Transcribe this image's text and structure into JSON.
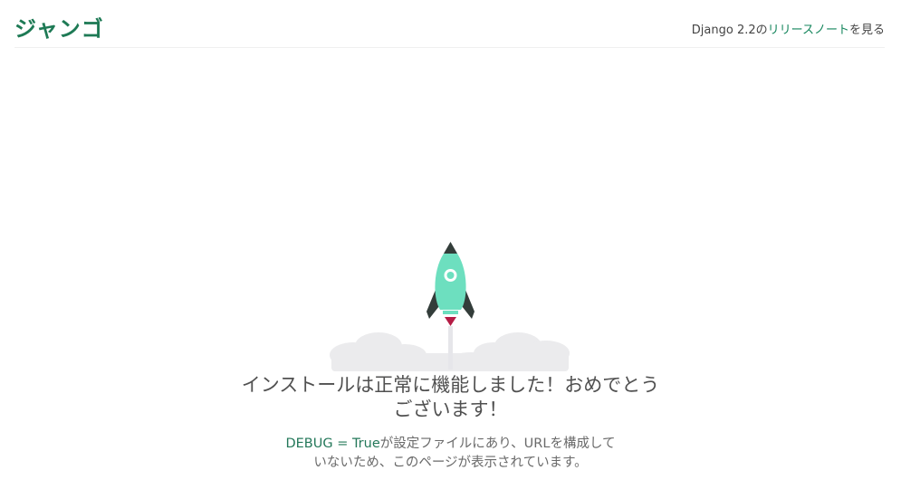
{
  "header": {
    "logo": "ジャンゴ",
    "release_prefix": "Django 2.2の",
    "release_link": "リリースノート",
    "release_suffix": "を見る"
  },
  "main": {
    "title_line1": "インストールは正常に機能しました！おめでとう",
    "title_line2": "ございます！",
    "debug_code": "DEBUG = True",
    "subtitle_line1_rest": "が設定ファイルにあり、URLを構成して",
    "subtitle_line2": "いないため、このページが表示されています。"
  },
  "colors": {
    "brand": "#1e7a55",
    "rocket_body": "#6ddfbf",
    "rocket_dark": "#333d3a",
    "flame": "#b51c45",
    "cloud": "#ebebed"
  }
}
